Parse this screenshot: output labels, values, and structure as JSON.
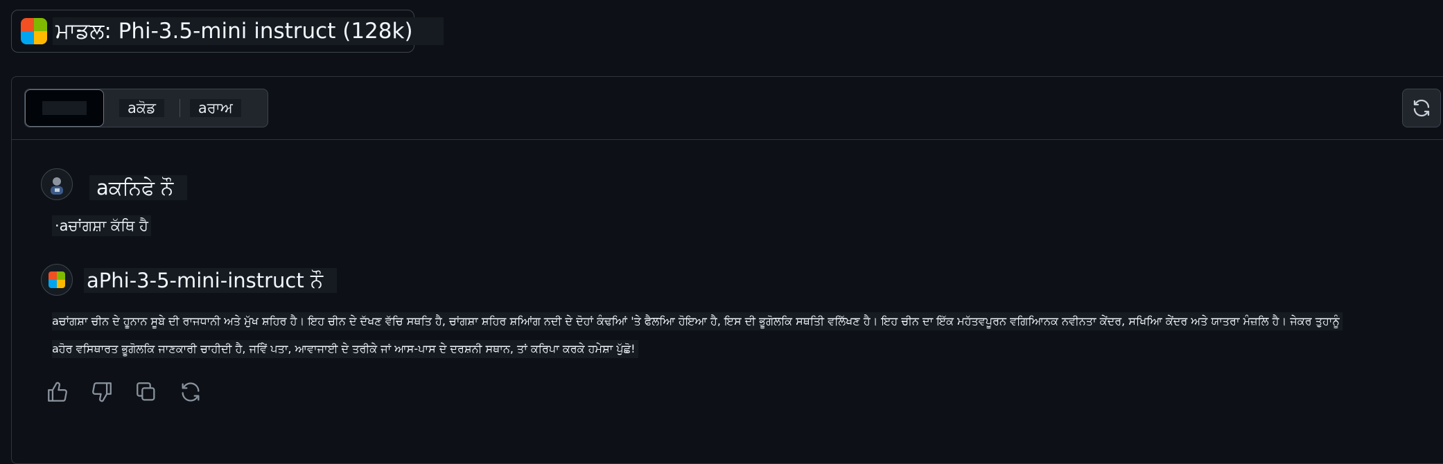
{
  "model_selector": {
    "label": "ਮਾਡਲ: Phi-3.5-mini instruct (128k)",
    "logo_colors": [
      "#f25022",
      "#7fba00",
      "#00a4ef",
      "#ffb900"
    ],
    "logo_icon": "microsoft-logo-icon"
  },
  "tabs": {
    "items": [
      {
        "label": "aਕੋਡ"
      },
      {
        "label": "aਰਾਅ"
      }
    ]
  },
  "refresh_icon": "refresh-icon",
  "chat": {
    "user": {
      "name": "aਕਨਿਫੇ ਨੌ",
      "avatar_icon": "user-avatar-icon",
      "message": "·aਚਾਂਗਸ਼ਾ ਕੱਥਿ ਹੈ"
    },
    "assistant": {
      "name": "aPhi-3-5-mini-instruct ਨੌ",
      "avatar_icon": "microsoft-logo-icon",
      "message_lines": [
        "aਚਾਂਗਸ਼ਾ ਚੀਨ ਦੇ ਹੂਨਾਨ ਸੂਬੇ ਦੀ ਰਾਜਧਾਨੀ ਅਤੇ ਮੁੱਖ ਸ਼ਹਿਰ ਹੈ। ਇਹ ਚੀਨ ਦੇ ਦੱਖਣ ਵੱਚਿ ਸਥਤਿ ਹੈ, ਚਾਂਗਸ਼ਾ ਸ਼ਹਿਰ ਸ਼ਆਿਂਗ ਨਦੀ ਦੇ ਦੋਹਾਂ ਕੰਢਆਿਂ 'ਤੇ ਫੈਲਆਿ ਹੋਇਆ ਹੈ, ਇਸ ਦੀ ਭੂਗੋਲਕਿ ਸਥਤਿੀ ਵਲਿੱਖਣ ਹੈ। ਇਹ ਚੀਨ ਦਾ ਇੱਕ ਮਹੱਤਵਪੂਰਨ ਵਗਿਆਿਨਕ ਨਵੀਨਤਾ ਕੇਂਦਰ, ਸਖਿਆਿ ਕੇਂਦਰ ਅਤੇ ਯਾਤਰਾ ਮੰਜ਼ਲਿ ਹੈ। ਜੇਕਰ ਤੁਹਾਨੂੰ",
        "aਹੋਰ ਵਸਿਥਾਰਤ ਭੂਗੋਲਕਿ ਜਾਣਕਾਰੀ ਚਾਹੀਦੀ ਹੈ, ਜਵਿੇਂ ਪਤਾ, ਆਵਾਜਾਈ ਦੇ ਤਰੀਕੇ ਜਾਂ ਆਸ-ਪਾਸ ਦੇ ਦਰਸ਼ਨੀ ਸਥਾਨ, ਤਾਂ ਕਰਿਪਾ ਕਰਕੇ ਹਮੇਸ਼ਾ ਪੁੱਛੋ!"
      ],
      "actions": [
        "thumbs-up-icon",
        "thumbs-down-icon",
        "copy-icon",
        "regenerate-icon"
      ]
    }
  }
}
